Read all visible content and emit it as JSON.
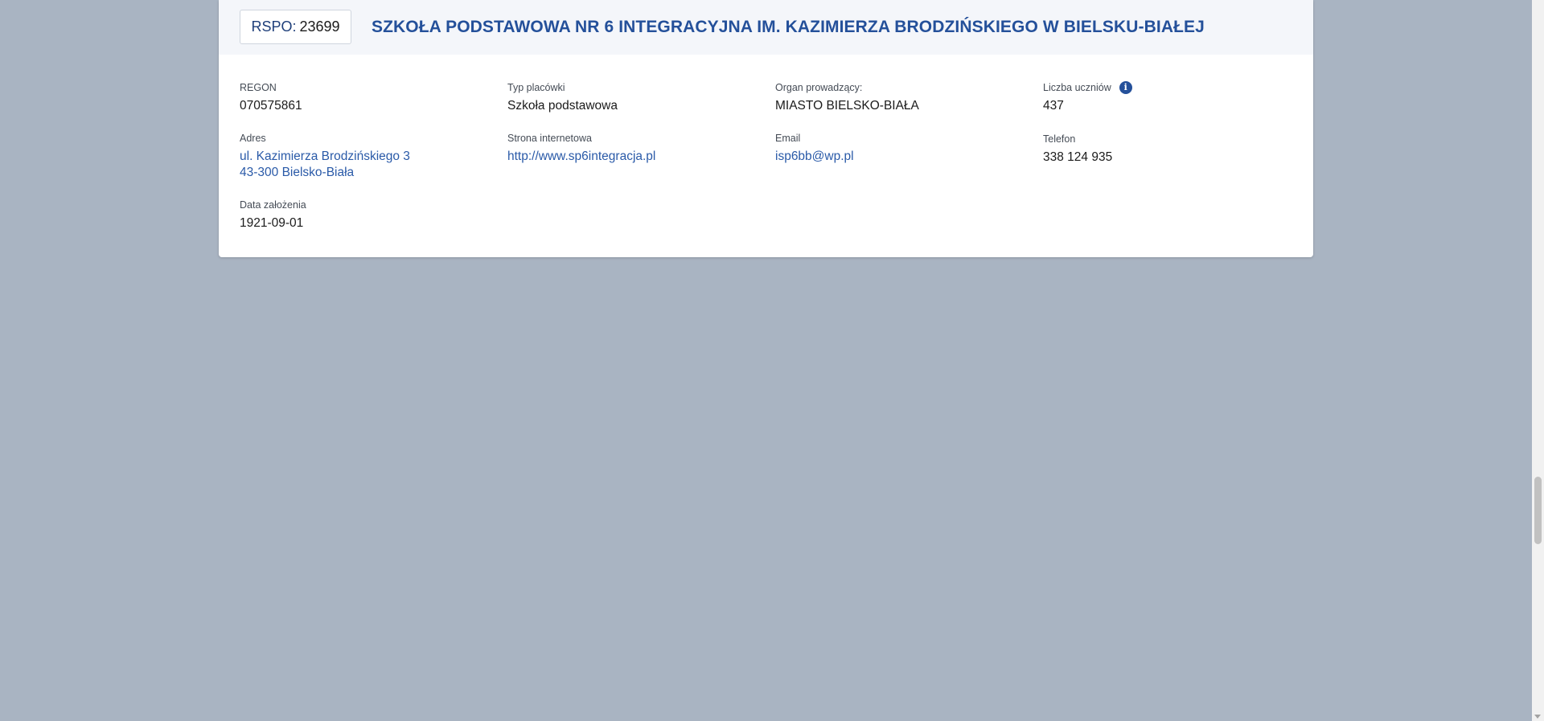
{
  "header": {
    "rspo_label": "RSPO:",
    "rspo_number": "23699",
    "school_name": "SZKOŁA PODSTAWOWA NR 6 INTEGRACYJNA IM. KAZIMIERZA BRODZIŃSKIEGO W BIELSKU-BIAŁEJ"
  },
  "fields": {
    "regon": {
      "label": "REGON",
      "value": "070575861"
    },
    "typ": {
      "label": "Typ placówki",
      "value": "Szkoła podstawowa"
    },
    "organ": {
      "label": "Organ prowadzący:",
      "value": "MIASTO BIELSKO-BIAŁA"
    },
    "uczniowie": {
      "label": "Liczba uczniów",
      "value": "437",
      "icon": "info-icon"
    },
    "adres": {
      "label": "Adres",
      "line1": "ul. Kazimierza Brodzińskiego 3",
      "line2": "43-300 Bielsko-Biała"
    },
    "www": {
      "label": "Strona internetowa",
      "value": "http://www.sp6integracja.pl"
    },
    "email": {
      "label": "Email",
      "value": "isp6bb@wp.pl"
    },
    "telefon": {
      "label": "Telefon",
      "value": "338 124 935"
    },
    "data": {
      "label": "Data założenia",
      "value": "1921-09-01"
    }
  },
  "colors": {
    "background": "#a9b4c2",
    "accent": "#24509a",
    "link": "#2a5aa8"
  }
}
